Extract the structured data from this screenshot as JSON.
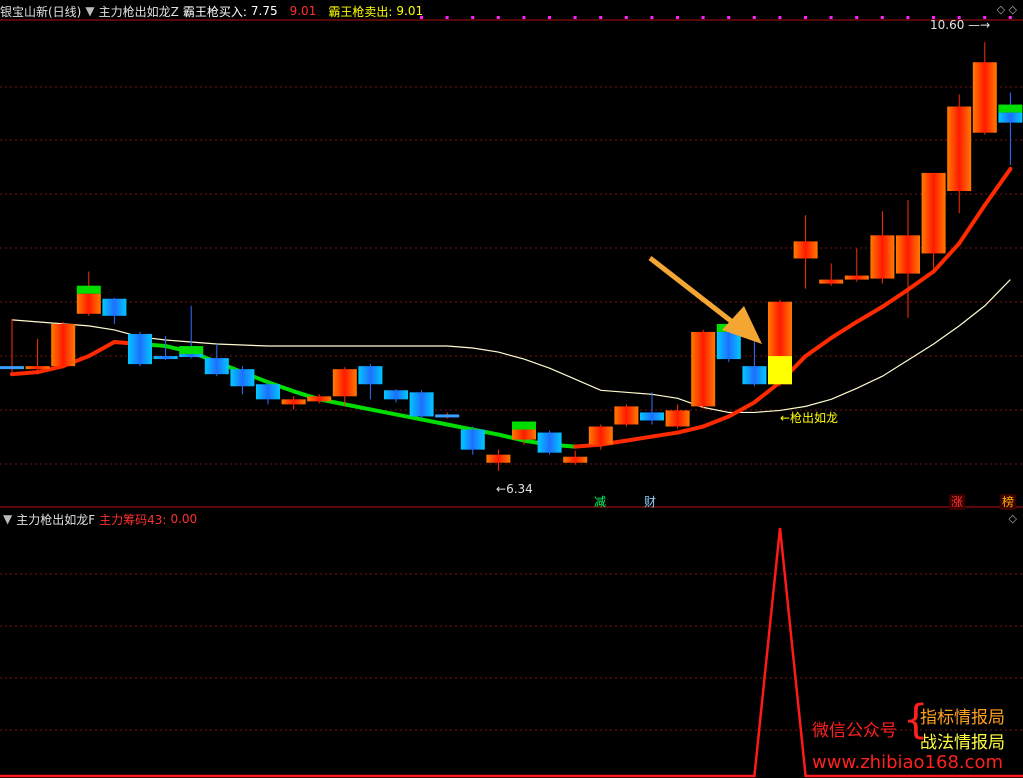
{
  "upper_header": {
    "stock_title": "银宝山新(日线)",
    "indicator_name": "主力枪出如龙Z",
    "buy_label": "霸王枪买入:",
    "buy_value": "7.75",
    "extra_value": "9.01",
    "sell_label": "霸王枪卖出:",
    "sell_value": "9.01"
  },
  "lower_header": {
    "indicator_name": "主力枪出如龙F",
    "series_label": "主力筹码43:",
    "series_value": "0.00"
  },
  "annotations": {
    "high_label": "10.60",
    "low_label": "6.34",
    "signal_label": "←枪出如龙"
  },
  "badges": {
    "jian": "减",
    "cai": "财",
    "zhang": "涨",
    "bang": "榜"
  },
  "watermark": {
    "left": "微信公众号",
    "line1": "指标情报局",
    "line2": "战法情报局",
    "url": "www.zhibiao168.com"
  },
  "colors": {
    "background": "#000000",
    "grid": "#7a1010",
    "up_candle": "#ff2a00",
    "down_candle": "#1e90ff",
    "green": "#00dd00",
    "yellow": "#ffff00",
    "arrow": "#f4a633"
  },
  "chart_data": [
    {
      "type": "candlestick",
      "panel": "main",
      "ylim": [
        6.0,
        10.8
      ],
      "candles": [
        {
          "o": 7.38,
          "c": 7.38,
          "h": 7.85,
          "l": 7.3,
          "dir": "flat"
        },
        {
          "o": 7.38,
          "c": 7.36,
          "h": 7.65,
          "l": 7.34,
          "dir": "up"
        },
        {
          "o": 7.38,
          "c": 7.8,
          "h": 7.82,
          "l": 7.36,
          "dir": "up"
        },
        {
          "o": 7.9,
          "c": 8.1,
          "h": 8.32,
          "l": 7.88,
          "dir": "up"
        },
        {
          "o": 8.05,
          "c": 7.88,
          "h": 8.06,
          "l": 7.8,
          "dir": "down"
        },
        {
          "o": 7.7,
          "c": 7.4,
          "h": 7.72,
          "l": 7.38,
          "dir": "down"
        },
        {
          "o": 7.48,
          "c": 7.46,
          "h": 7.68,
          "l": 7.44,
          "dir": "down"
        },
        {
          "o": 7.5,
          "c": 7.48,
          "h": 7.98,
          "l": 7.46,
          "dir": "down"
        },
        {
          "o": 7.46,
          "c": 7.3,
          "h": 7.6,
          "l": 7.28,
          "dir": "down"
        },
        {
          "o": 7.35,
          "c": 7.18,
          "h": 7.38,
          "l": 7.1,
          "dir": "down"
        },
        {
          "o": 7.2,
          "c": 7.05,
          "h": 7.22,
          "l": 7.0,
          "dir": "down"
        },
        {
          "o": 7.05,
          "c": 7.0,
          "h": 7.08,
          "l": 6.95,
          "dir": "up"
        },
        {
          "o": 7.03,
          "c": 7.08,
          "h": 7.1,
          "l": 7.01,
          "dir": "up"
        },
        {
          "o": 7.08,
          "c": 7.35,
          "h": 7.37,
          "l": 6.98,
          "dir": "up"
        },
        {
          "o": 7.38,
          "c": 7.2,
          "h": 7.4,
          "l": 7.05,
          "dir": "down"
        },
        {
          "o": 7.14,
          "c": 7.05,
          "h": 7.15,
          "l": 7.02,
          "dir": "down"
        },
        {
          "o": 7.12,
          "c": 6.88,
          "h": 7.14,
          "l": 6.86,
          "dir": "down"
        },
        {
          "o": 6.9,
          "c": 6.88,
          "h": 6.92,
          "l": 6.86,
          "dir": "flat"
        },
        {
          "o": 6.75,
          "c": 6.55,
          "h": 6.78,
          "l": 6.5,
          "dir": "down"
        },
        {
          "o": 6.5,
          "c": 6.42,
          "h": 6.55,
          "l": 6.34,
          "dir": "up"
        },
        {
          "o": 6.65,
          "c": 6.75,
          "h": 6.78,
          "l": 6.6,
          "dir": "up"
        },
        {
          "o": 6.72,
          "c": 6.52,
          "h": 6.74,
          "l": 6.5,
          "dir": "down"
        },
        {
          "o": 6.42,
          "c": 6.48,
          "h": 6.54,
          "l": 6.4,
          "dir": "up"
        },
        {
          "o": 6.6,
          "c": 6.78,
          "h": 6.8,
          "l": 6.55,
          "dir": "up"
        },
        {
          "o": 6.8,
          "c": 6.98,
          "h": 7.0,
          "l": 6.78,
          "dir": "up"
        },
        {
          "o": 6.92,
          "c": 6.84,
          "h": 7.12,
          "l": 6.8,
          "dir": "down"
        },
        {
          "o": 6.78,
          "c": 6.94,
          "h": 7.0,
          "l": 6.76,
          "dir": "up"
        },
        {
          "o": 6.98,
          "c": 7.72,
          "h": 7.74,
          "l": 6.96,
          "dir": "up"
        },
        {
          "o": 7.72,
          "c": 7.45,
          "h": 7.78,
          "l": 7.42,
          "dir": "down"
        },
        {
          "o": 7.38,
          "c": 7.2,
          "h": 7.65,
          "l": 7.18,
          "dir": "down"
        },
        {
          "o": 7.2,
          "c": 8.02,
          "h": 8.04,
          "l": 7.18,
          "dir": "up"
        },
        {
          "o": 8.45,
          "c": 8.62,
          "h": 8.88,
          "l": 8.15,
          "dir": "up"
        },
        {
          "o": 8.2,
          "c": 8.24,
          "h": 8.4,
          "l": 8.18,
          "dir": "up"
        },
        {
          "o": 8.24,
          "c": 8.28,
          "h": 8.55,
          "l": 8.22,
          "dir": "up"
        },
        {
          "o": 8.25,
          "c": 8.68,
          "h": 8.92,
          "l": 8.2,
          "dir": "up"
        },
        {
          "o": 8.3,
          "c": 8.68,
          "h": 9.03,
          "l": 7.86,
          "dir": "up"
        },
        {
          "o": 8.5,
          "c": 9.3,
          "h": 9.3,
          "l": 8.3,
          "dir": "up"
        },
        {
          "o": 9.12,
          "c": 9.96,
          "h": 10.08,
          "l": 8.9,
          "dir": "up"
        },
        {
          "o": 9.7,
          "c": 10.4,
          "h": 10.6,
          "l": 9.68,
          "dir": "up"
        },
        {
          "o": 9.9,
          "c": 9.8,
          "h": 10.1,
          "l": 9.38,
          "dir": "down"
        }
      ],
      "trend_line": [
        7.3,
        7.32,
        7.38,
        7.48,
        7.62,
        7.6,
        7.58,
        7.52,
        7.42,
        7.32,
        7.22,
        7.13,
        7.05,
        7.0,
        6.95,
        6.9,
        6.85,
        6.8,
        6.75,
        6.7,
        6.64,
        6.6,
        6.58,
        6.6,
        6.64,
        6.68,
        6.72,
        6.78,
        6.88,
        7.02,
        7.22,
        7.48,
        7.66,
        7.82,
        7.97,
        8.14,
        8.32,
        8.6,
        8.98,
        9.34
      ],
      "ma_line": [
        7.84,
        7.82,
        7.8,
        7.78,
        7.74,
        7.67,
        7.64,
        7.62,
        7.6,
        7.59,
        7.58,
        7.58,
        7.58,
        7.58,
        7.58,
        7.58,
        7.58,
        7.58,
        7.56,
        7.52,
        7.45,
        7.36,
        7.25,
        7.14,
        7.12,
        7.1,
        7.06,
        6.97,
        6.92,
        6.92,
        6.94,
        6.98,
        7.05,
        7.16,
        7.28,
        7.44,
        7.6,
        7.78,
        7.98,
        8.24
      ]
    },
    {
      "type": "line",
      "panel": "sub",
      "title": "主力筹码43",
      "ylim": [
        0,
        1
      ],
      "values": [
        0,
        0,
        0,
        0,
        0,
        0,
        0,
        0,
        0,
        0,
        0,
        0,
        0,
        0,
        0,
        0,
        0,
        0,
        0,
        0,
        0,
        0,
        0,
        0,
        0,
        0,
        0,
        0,
        0,
        0,
        1,
        0,
        0,
        0,
        0,
        0,
        0,
        0,
        0,
        0
      ]
    }
  ]
}
